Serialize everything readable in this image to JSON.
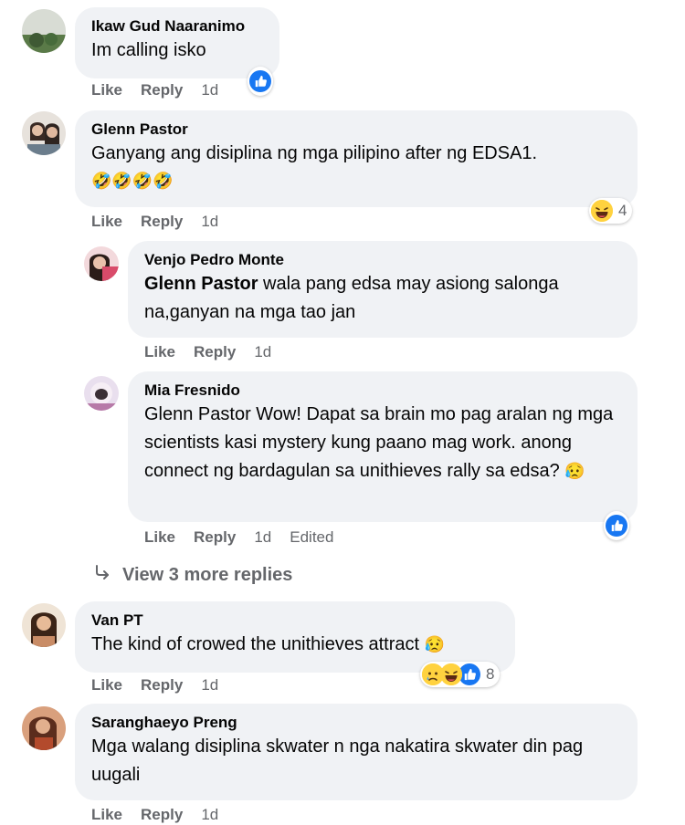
{
  "action_labels": {
    "like": "Like",
    "reply": "Reply",
    "edited": "Edited"
  },
  "comments": [
    {
      "name": "Ikaw Gud Naaranimo",
      "text": "Im calling isko",
      "time": "1d",
      "reaction_count": ""
    },
    {
      "name": "Glenn Pastor",
      "text": "Ganyang ang disiplina ng mga pilipino after ng EDSA1.",
      "emoji_line": "🤣🤣🤣🤣",
      "time": "1d",
      "reaction_count": "4"
    },
    {
      "name": "Venjo Pedro Monte",
      "tag": "Glenn Pastor",
      "text": " wala pang edsa may asiong salonga na,ganyan na mga tao jan",
      "time": "1d"
    },
    {
      "name": "Mia Fresnido",
      "text": "Glenn Pastor Wow! Dapat sa brain mo pag aralan ng mga scientists kasi mystery kung paano mag work. anong connect ng bardagulan sa unithieves rally sa edsa?",
      "text_emoji": "😥",
      "time": "1d"
    },
    {
      "name": "Van PT",
      "text": "The kind of crowed the unithieves attract",
      "text_emoji": "😥",
      "time": "1d",
      "reaction_count": "8"
    },
    {
      "name": "Saranghaeyo Preng",
      "text": "Mga walang disiplina skwater n nga nakatira skwater din pag uugali",
      "time": "1d"
    }
  ],
  "view_more": "View 3 more replies",
  "colors": {
    "bubble": "#f0f2f5",
    "muted": "#65676b",
    "like_blue": "#1877f2",
    "emoji_yellow": "#ffd23f"
  }
}
